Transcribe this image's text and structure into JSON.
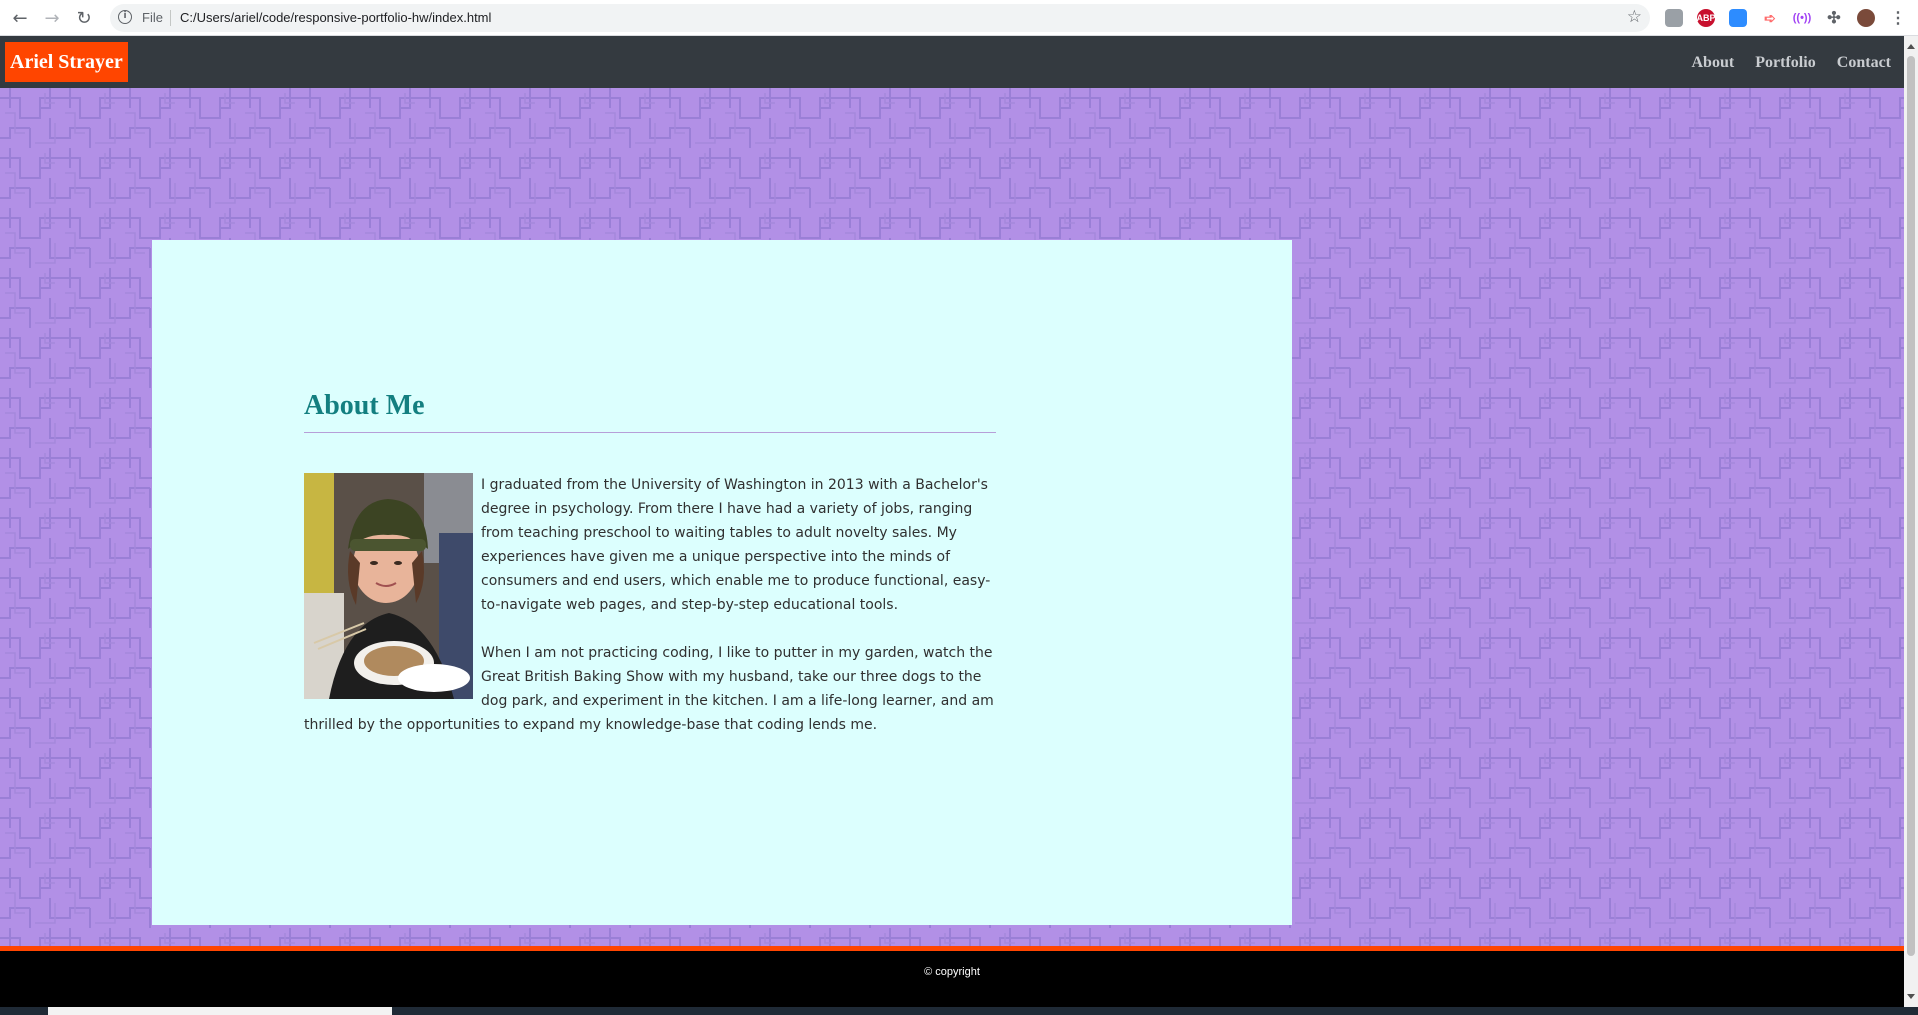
{
  "browser": {
    "file_label": "File",
    "url": "C:/Users/ariel/code/responsive-portfolio-hw/index.html",
    "extensions": [
      {
        "icon": "pdf-extension-icon",
        "color": "#9aa0a6",
        "label": ""
      },
      {
        "icon": "adblock-plus-icon",
        "color": "#c8102e",
        "label": "ABP"
      },
      {
        "icon": "zoom-extension-icon",
        "color": "#2d8cff",
        "label": ""
      },
      {
        "icon": "share-extension-icon",
        "color": "#ff6b6b",
        "label": ""
      },
      {
        "icon": "broadcast-extension-icon",
        "color": "#a142f4",
        "label": ""
      }
    ]
  },
  "header": {
    "brand": "Ariel Strayer",
    "nav": [
      "About",
      "Portfolio",
      "Contact"
    ]
  },
  "about": {
    "title": "About Me",
    "paragraphs": [
      "I graduated from the University of Washington in 2013 with a Bachelor's degree in psychology. From there I have had a variety of jobs, ranging from teaching preschool to waiting tables to adult novelty sales. My experiences have given me a unique perspective into the minds of consumers and end users, which enable me to produce functional, easy-to-navigate web pages, and step-by-step educational tools.",
      "When I am not practicing coding, I like to putter in my garden, watch the Great British Baking Show with my husband, take our three dogs to the dog park, and experiment in the kitchen. I am a life-long learner, and am thrilled by the opportunities to expand my knowledge-base that coding lends me."
    ]
  },
  "footer": {
    "copyright": "© copyright"
  },
  "colors": {
    "brand_bg": "#ff4500",
    "header_bg": "#343a40",
    "page_bg": "#b290e6",
    "card_bg": "#dcfffe",
    "title": "#137f80",
    "footer_bg": "#000000"
  }
}
